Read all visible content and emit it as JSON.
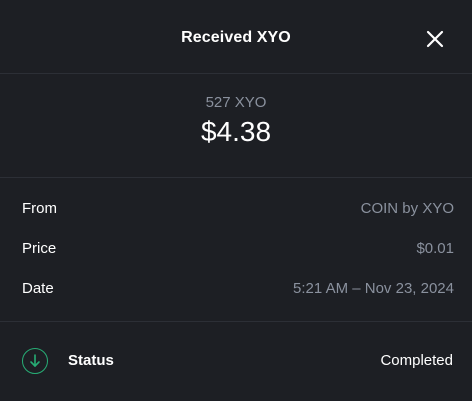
{
  "header": {
    "title": "Received XYO",
    "close_icon": "close-icon"
  },
  "amount": {
    "crypto": "527 XYO",
    "fiat": "$4.38"
  },
  "details": {
    "rows": [
      {
        "label": "From",
        "value": "COIN by XYO"
      },
      {
        "label": "Price",
        "value": "$0.01"
      },
      {
        "label": "Date",
        "value": "5:21 AM – Nov 23, 2024"
      }
    ]
  },
  "status": {
    "icon": "arrow-down-icon",
    "label": "Status",
    "value": "Completed",
    "accent_color": "#27ad75"
  },
  "colors": {
    "background": "#1d1f24",
    "muted_text": "#8a919e",
    "divider": "#2c2f36"
  }
}
